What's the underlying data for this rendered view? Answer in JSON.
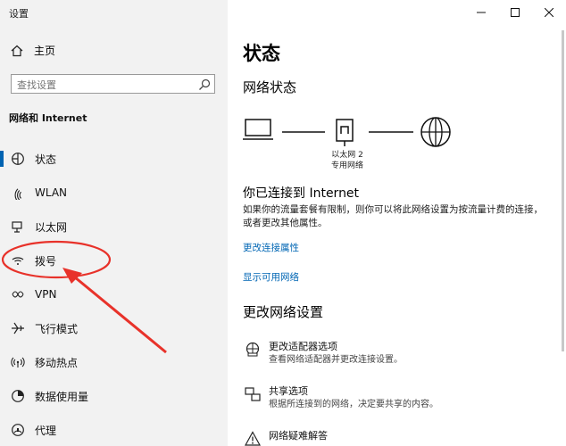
{
  "window": {
    "title": "设置"
  },
  "sidebar": {
    "home_label": "主页",
    "search_placeholder": "查找设置",
    "section_title": "网络和 Internet",
    "items": [
      {
        "label": "状态",
        "icon": "status-icon",
        "active": true
      },
      {
        "label": "WLAN",
        "icon": "wifi-icon"
      },
      {
        "label": "以太网",
        "icon": "ethernet-icon"
      },
      {
        "label": "拨号",
        "icon": "dialup-icon"
      },
      {
        "label": "VPN",
        "icon": "vpn-icon"
      },
      {
        "label": "飞行模式",
        "icon": "airplane-icon"
      },
      {
        "label": "移动热点",
        "icon": "hotspot-icon"
      },
      {
        "label": "数据使用量",
        "icon": "data-usage-icon"
      },
      {
        "label": "代理",
        "icon": "proxy-icon"
      }
    ]
  },
  "main": {
    "title": "状态",
    "network_status_heading": "网络状态",
    "adapter_name": "以太网 2",
    "network_type": "专用网络",
    "connection_title": "你已连接到 Internet",
    "connection_desc": "如果你的流量套餐有限制，则你可以将此网络设置为按流量计费的连接，或者更改其他属性。",
    "links": {
      "change_properties": "更改连接属性",
      "show_networks": "显示可用网络"
    },
    "change_settings_heading": "更改网络设置",
    "settings": [
      {
        "title": "更改适配器选项",
        "desc": "查看网络适配器并更改连接设置。",
        "icon": "adapter-icon"
      },
      {
        "title": "共享选项",
        "desc": "根据所连接到的网络，决定要共享的内容。",
        "icon": "sharing-icon"
      },
      {
        "title": "网络疑难解答",
        "desc": "",
        "icon": "troubleshoot-icon"
      }
    ]
  },
  "colors": {
    "accent": "#0063b1",
    "link": "#0066b4",
    "annotation": "#e8322a",
    "sidebar_bg": "#f2f2f2"
  }
}
